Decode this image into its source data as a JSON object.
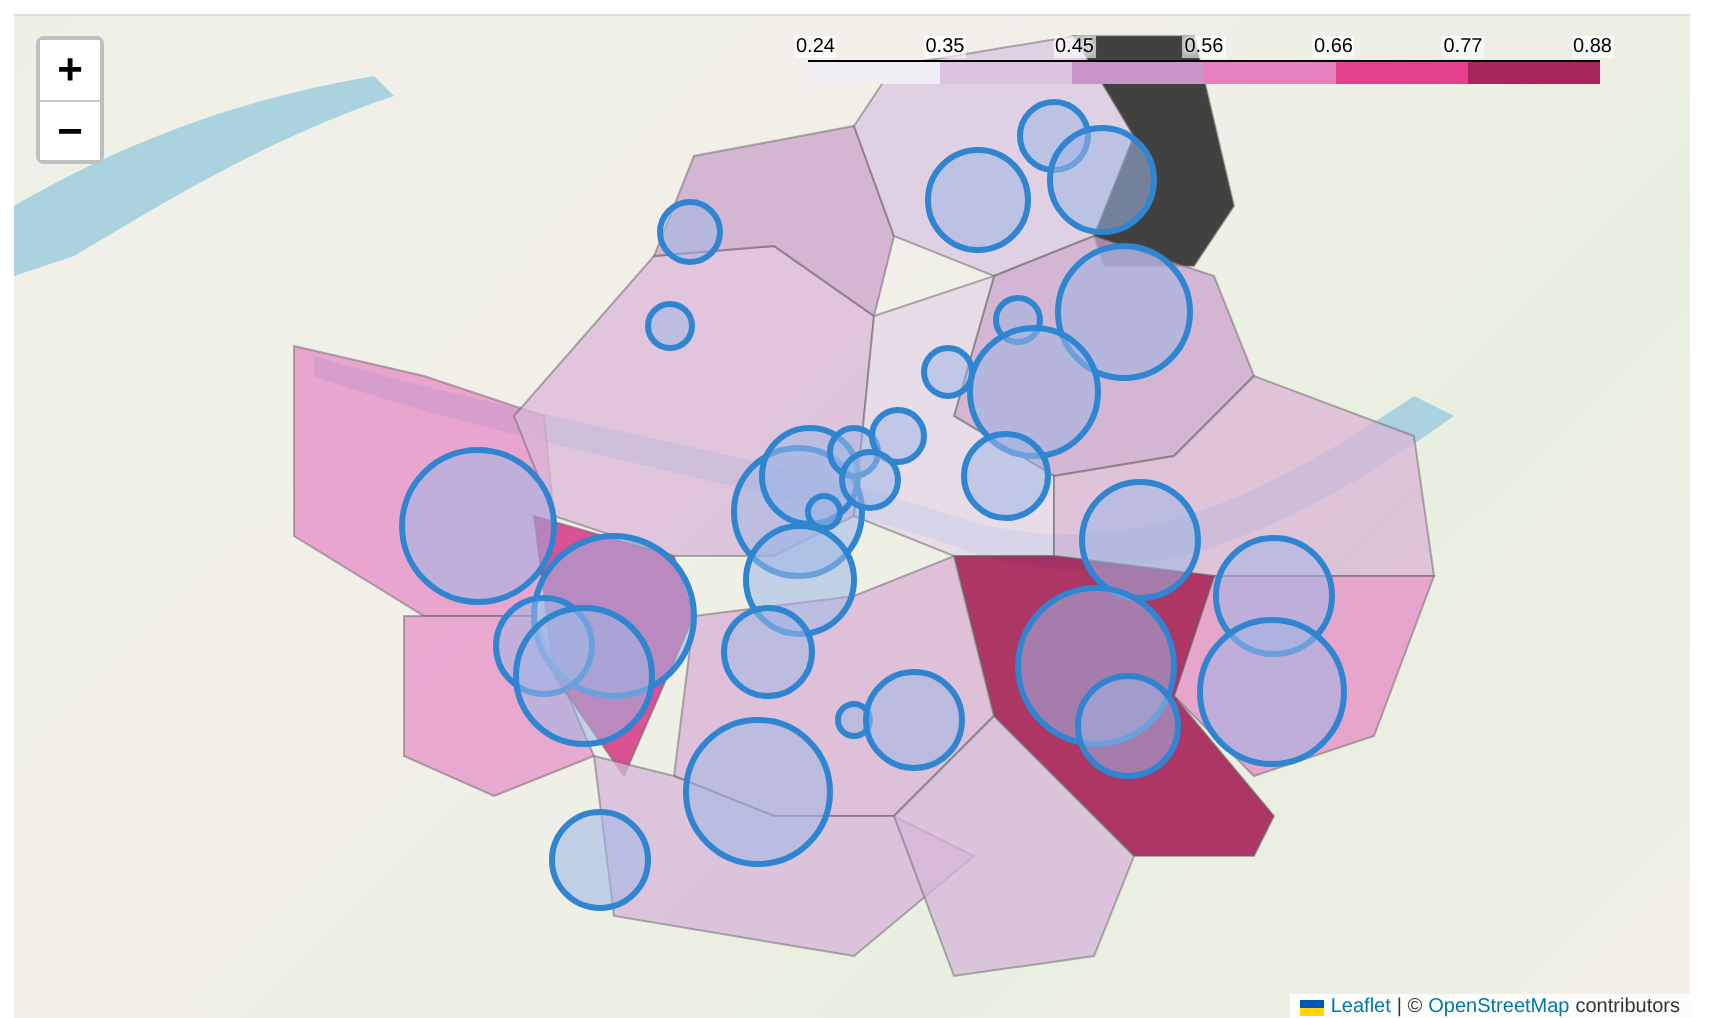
{
  "map": {
    "zoom_in": "+",
    "zoom_out": "−"
  },
  "legend": {
    "ticks": [
      "0.24",
      "0.35",
      "0.45",
      "0.56",
      "0.66",
      "0.77",
      "0.88"
    ],
    "bins": [
      {
        "color": "#f1eef6"
      },
      {
        "color": "#dcc3df"
      },
      {
        "color": "#c994c7"
      },
      {
        "color": "#e57fbd"
      },
      {
        "color": "#e4418f"
      },
      {
        "color": "#a8265a"
      }
    ]
  },
  "attribution": {
    "library_link": "Leaflet",
    "separator": "| ©",
    "osm_link": "OpenStreetMap",
    "suffix": "contributors"
  }
}
